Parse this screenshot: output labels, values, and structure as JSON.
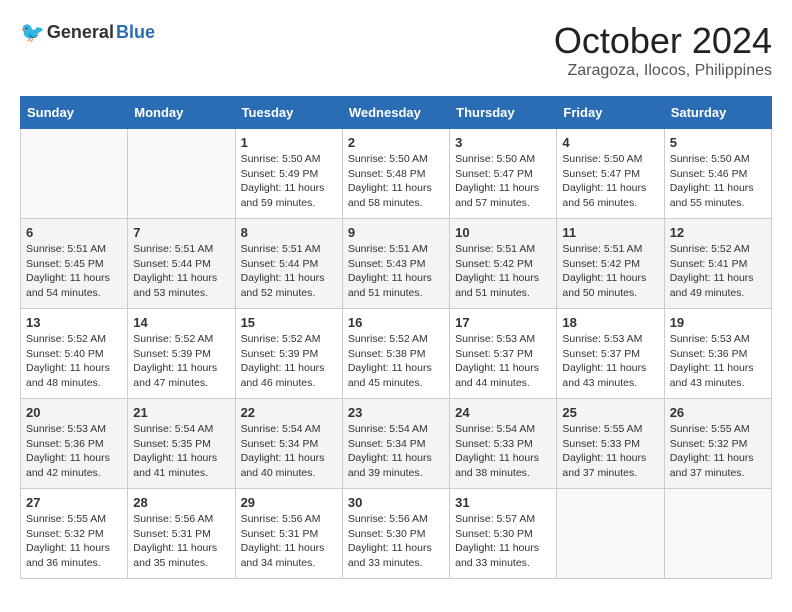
{
  "header": {
    "logo_general": "General",
    "logo_blue": "Blue",
    "month": "October 2024",
    "location": "Zaragoza, Ilocos, Philippines"
  },
  "weekdays": [
    "Sunday",
    "Monday",
    "Tuesday",
    "Wednesday",
    "Thursday",
    "Friday",
    "Saturday"
  ],
  "weeks": [
    [
      {
        "day": "",
        "info": ""
      },
      {
        "day": "",
        "info": ""
      },
      {
        "day": "1",
        "info": "Sunrise: 5:50 AM\nSunset: 5:49 PM\nDaylight: 11 hours\nand 59 minutes."
      },
      {
        "day": "2",
        "info": "Sunrise: 5:50 AM\nSunset: 5:48 PM\nDaylight: 11 hours\nand 58 minutes."
      },
      {
        "day": "3",
        "info": "Sunrise: 5:50 AM\nSunset: 5:47 PM\nDaylight: 11 hours\nand 57 minutes."
      },
      {
        "day": "4",
        "info": "Sunrise: 5:50 AM\nSunset: 5:47 PM\nDaylight: 11 hours\nand 56 minutes."
      },
      {
        "day": "5",
        "info": "Sunrise: 5:50 AM\nSunset: 5:46 PM\nDaylight: 11 hours\nand 55 minutes."
      }
    ],
    [
      {
        "day": "6",
        "info": "Sunrise: 5:51 AM\nSunset: 5:45 PM\nDaylight: 11 hours\nand 54 minutes."
      },
      {
        "day": "7",
        "info": "Sunrise: 5:51 AM\nSunset: 5:44 PM\nDaylight: 11 hours\nand 53 minutes."
      },
      {
        "day": "8",
        "info": "Sunrise: 5:51 AM\nSunset: 5:44 PM\nDaylight: 11 hours\nand 52 minutes."
      },
      {
        "day": "9",
        "info": "Sunrise: 5:51 AM\nSunset: 5:43 PM\nDaylight: 11 hours\nand 51 minutes."
      },
      {
        "day": "10",
        "info": "Sunrise: 5:51 AM\nSunset: 5:42 PM\nDaylight: 11 hours\nand 51 minutes."
      },
      {
        "day": "11",
        "info": "Sunrise: 5:51 AM\nSunset: 5:42 PM\nDaylight: 11 hours\nand 50 minutes."
      },
      {
        "day": "12",
        "info": "Sunrise: 5:52 AM\nSunset: 5:41 PM\nDaylight: 11 hours\nand 49 minutes."
      }
    ],
    [
      {
        "day": "13",
        "info": "Sunrise: 5:52 AM\nSunset: 5:40 PM\nDaylight: 11 hours\nand 48 minutes."
      },
      {
        "day": "14",
        "info": "Sunrise: 5:52 AM\nSunset: 5:39 PM\nDaylight: 11 hours\nand 47 minutes."
      },
      {
        "day": "15",
        "info": "Sunrise: 5:52 AM\nSunset: 5:39 PM\nDaylight: 11 hours\nand 46 minutes."
      },
      {
        "day": "16",
        "info": "Sunrise: 5:52 AM\nSunset: 5:38 PM\nDaylight: 11 hours\nand 45 minutes."
      },
      {
        "day": "17",
        "info": "Sunrise: 5:53 AM\nSunset: 5:37 PM\nDaylight: 11 hours\nand 44 minutes."
      },
      {
        "day": "18",
        "info": "Sunrise: 5:53 AM\nSunset: 5:37 PM\nDaylight: 11 hours\nand 43 minutes."
      },
      {
        "day": "19",
        "info": "Sunrise: 5:53 AM\nSunset: 5:36 PM\nDaylight: 11 hours\nand 43 minutes."
      }
    ],
    [
      {
        "day": "20",
        "info": "Sunrise: 5:53 AM\nSunset: 5:36 PM\nDaylight: 11 hours\nand 42 minutes."
      },
      {
        "day": "21",
        "info": "Sunrise: 5:54 AM\nSunset: 5:35 PM\nDaylight: 11 hours\nand 41 minutes."
      },
      {
        "day": "22",
        "info": "Sunrise: 5:54 AM\nSunset: 5:34 PM\nDaylight: 11 hours\nand 40 minutes."
      },
      {
        "day": "23",
        "info": "Sunrise: 5:54 AM\nSunset: 5:34 PM\nDaylight: 11 hours\nand 39 minutes."
      },
      {
        "day": "24",
        "info": "Sunrise: 5:54 AM\nSunset: 5:33 PM\nDaylight: 11 hours\nand 38 minutes."
      },
      {
        "day": "25",
        "info": "Sunrise: 5:55 AM\nSunset: 5:33 PM\nDaylight: 11 hours\nand 37 minutes."
      },
      {
        "day": "26",
        "info": "Sunrise: 5:55 AM\nSunset: 5:32 PM\nDaylight: 11 hours\nand 37 minutes."
      }
    ],
    [
      {
        "day": "27",
        "info": "Sunrise: 5:55 AM\nSunset: 5:32 PM\nDaylight: 11 hours\nand 36 minutes."
      },
      {
        "day": "28",
        "info": "Sunrise: 5:56 AM\nSunset: 5:31 PM\nDaylight: 11 hours\nand 35 minutes."
      },
      {
        "day": "29",
        "info": "Sunrise: 5:56 AM\nSunset: 5:31 PM\nDaylight: 11 hours\nand 34 minutes."
      },
      {
        "day": "30",
        "info": "Sunrise: 5:56 AM\nSunset: 5:30 PM\nDaylight: 11 hours\nand 33 minutes."
      },
      {
        "day": "31",
        "info": "Sunrise: 5:57 AM\nSunset: 5:30 PM\nDaylight: 11 hours\nand 33 minutes."
      },
      {
        "day": "",
        "info": ""
      },
      {
        "day": "",
        "info": ""
      }
    ]
  ]
}
